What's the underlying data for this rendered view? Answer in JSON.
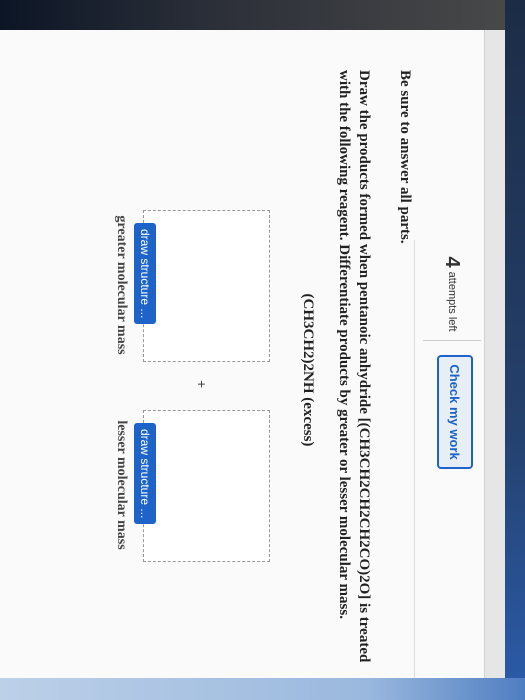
{
  "header": {
    "attempts_number": "4",
    "attempts_label": "attempts left",
    "check_button": "Check my work"
  },
  "question": {
    "instruction": "Be sure to answer all parts.",
    "prompt": "Draw the products formed when pentanoic anhydride [(CH3CH2CH2CH2CO)2O] is treated with the following reagent. Differentiate products by greater or lesser molecular mass.",
    "reagent": "(CH3CH2)2NH (excess)"
  },
  "answers": {
    "plus": "+",
    "left_button": "draw structure ...",
    "right_button": "draw structure ...",
    "left_caption": "greater molecular mass",
    "right_caption": "lesser molecular mass"
  }
}
